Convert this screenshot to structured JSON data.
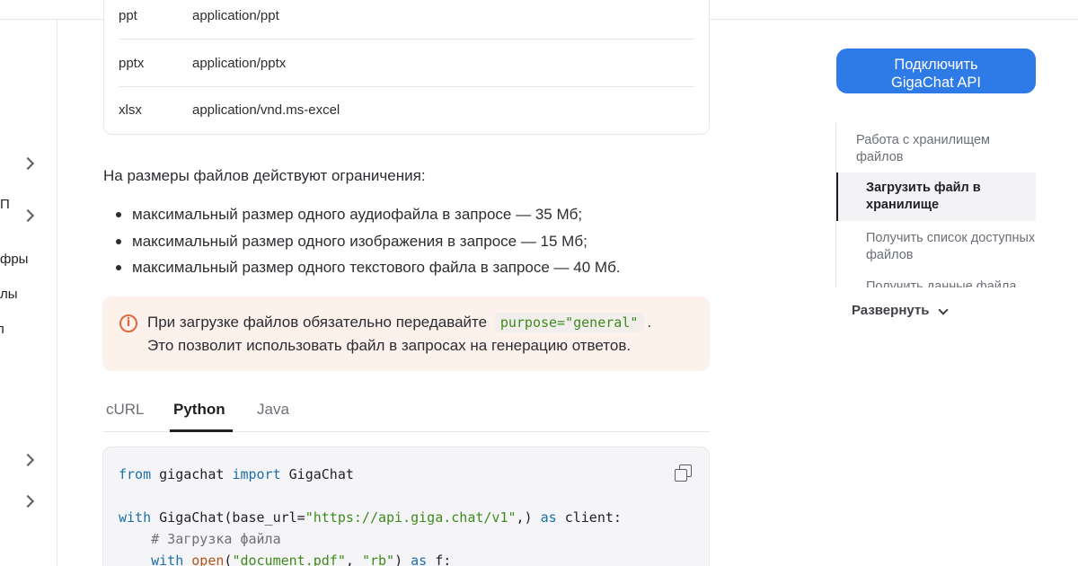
{
  "sidebar": {
    "items": [
      {
        "label": ""
      },
      {
        "label": "П"
      },
      {
        "label": "фры"
      },
      {
        "label": "лы"
      },
      {
        "label": "л"
      },
      {
        "label": ""
      },
      {
        "label": ""
      }
    ]
  },
  "mime_table": {
    "rows": [
      {
        "ext": "ppt",
        "mime": "application/ppt"
      },
      {
        "ext": "pptx",
        "mime": "application/pptx"
      },
      {
        "ext": "xlsx",
        "mime": "application/vnd.ms-excel"
      }
    ]
  },
  "limits": {
    "intro": "На размеры файлов действуют ограничения:",
    "items": [
      "максимальный размер одного аудиофайла в запросе — 35 Мб;",
      "максимальный размер одного изображения в запросе — 15 Мб;",
      "максимальный размер одного текстового файла в запросе — 40 Мб."
    ]
  },
  "notice": {
    "icon": "info-icon",
    "text_before": "При загрузке файлов обязательно передавайте",
    "code": "purpose=\"general\"",
    "text_after": ".",
    "line2": "Это позволит использовать файл в запросах на генерацию ответов."
  },
  "code_tabs": {
    "tabs": [
      "cURL",
      "Python",
      "Java"
    ],
    "active": "Python"
  },
  "code": {
    "l1_from": "from",
    "l1_mod": " gigachat ",
    "l1_import": "import",
    "l1_name": " GigaChat",
    "l2_with": "with",
    "l2_call": " GigaChat",
    "l2_paren": "(base_url=",
    "l2_url": "\"https://api.giga.chat/v1\"",
    "l2_close": ",)",
    "l2_as": " as",
    "l2_client": " client:",
    "l3_comment": "    # Загрузка файла",
    "l4_with": "    with",
    "l4_open": " open",
    "l4_paren": "(",
    "l4_file": "\"document.pdf\"",
    "l4_comma": ", ",
    "l4_mode": "\"rb\"",
    "l4_close": ")",
    "l4_as": " as",
    "l4_f": " f:"
  },
  "cta": {
    "line1": "Подключить",
    "line2": "GigaChat API"
  },
  "toc": {
    "items": [
      "Работа с хранилищем файлов",
      "Загрузить файл в хранилище",
      "Получить список доступных файлов",
      "Получить данные файла"
    ],
    "expand_label": "Развернуть"
  }
}
